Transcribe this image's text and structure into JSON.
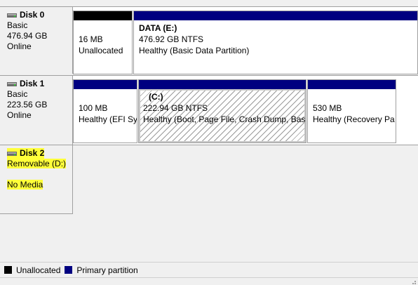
{
  "disks": [
    {
      "name": "Disk 0",
      "type": "Basic",
      "size": "476.94 GB",
      "status": "Online",
      "partitions": [
        {
          "label": "",
          "size": "16 MB",
          "status": "Unallocated",
          "kind": "unallocated"
        },
        {
          "label": "DATA  (E:)",
          "size": "476.92 GB NTFS",
          "status": "Healthy (Basic Data Partition)",
          "kind": "primary"
        }
      ]
    },
    {
      "name": "Disk 1",
      "type": "Basic",
      "size": "223.56 GB",
      "status": "Online",
      "partitions": [
        {
          "label": "",
          "size": "100 MB",
          "status": "Healthy (EFI Sy",
          "kind": "primary"
        },
        {
          "label": "(C:)",
          "size": "222.94 GB NTFS",
          "status": "Healthy (Boot, Page File, Crash Dump, Basic",
          "kind": "primary",
          "selected": true
        },
        {
          "label": "",
          "size": "530 MB",
          "status": "Healthy (Recovery Pa",
          "kind": "primary"
        }
      ]
    },
    {
      "name": "Disk 2",
      "type": "Removable (D:)",
      "status": "No Media"
    }
  ],
  "legend": [
    {
      "label": "Unallocated",
      "color": "#000000"
    },
    {
      "label": "Primary partition",
      "color": "#000080"
    }
  ]
}
